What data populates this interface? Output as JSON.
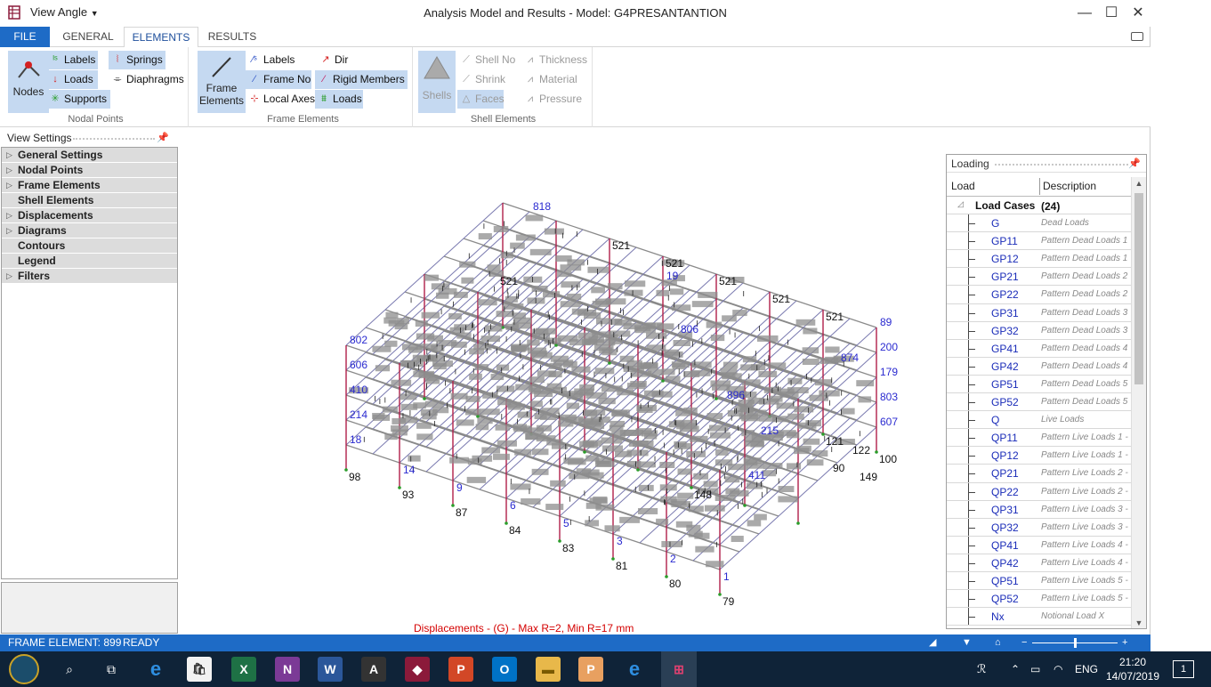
{
  "window": {
    "view_angle_label": "View Angle",
    "title": "Analysis Model and Results - Model: G4PRESANTANTION",
    "min_glyph": "—",
    "max_glyph": "☐",
    "close_glyph": "✕"
  },
  "tabs": {
    "file": "FILE",
    "general": "GENERAL",
    "elements": "ELEMENTS",
    "results": "RESULTS"
  },
  "ribbon": {
    "nodal": {
      "caption": "Nodal Points",
      "nodes": "Nodes",
      "labels": "Labels",
      "loads": "Loads",
      "supports": "Supports",
      "springs": "Springs",
      "diaphragms": "Diaphragms"
    },
    "frame": {
      "caption": "Frame Elements",
      "frame_line1": "Frame",
      "frame_line2": "Elements",
      "labels": "Labels",
      "frame_no": "Frame No",
      "local_axes": "Local Axes",
      "dir": "Dir",
      "rigid_members": "Rigid Members",
      "loads": "Loads"
    },
    "shell": {
      "caption": "Shell Elements",
      "shells": "Shells",
      "shell_no": "Shell  No",
      "shrink": "Shrink",
      "faces": "Faces",
      "thickness": "Thickness",
      "material": "Material",
      "pressure": "Pressure"
    }
  },
  "view_settings": {
    "title": "View Settings",
    "items": [
      {
        "label": "General Settings",
        "expandable": true
      },
      {
        "label": "Nodal Points",
        "expandable": true
      },
      {
        "label": "Frame Elements",
        "expandable": true
      },
      {
        "label": "Shell Elements",
        "expandable": false
      },
      {
        "label": "Displacements",
        "expandable": true
      },
      {
        "label": "Diagrams",
        "expandable": true
      },
      {
        "label": "Contours",
        "expandable": false
      },
      {
        "label": "Legend",
        "expandable": false
      },
      {
        "label": "Filters",
        "expandable": true
      }
    ]
  },
  "canvas": {
    "caption": "Displacements - (G) - Max  R=2, Min  R=17 mm",
    "node_labels": [
      {
        "t": "98"
      },
      {
        "t": "93"
      },
      {
        "t": "87"
      },
      {
        "t": "84"
      },
      {
        "t": "83"
      },
      {
        "t": "81"
      },
      {
        "t": "80"
      },
      {
        "t": "79"
      },
      {
        "t": "100"
      },
      {
        "t": "149"
      },
      {
        "t": "90"
      },
      {
        "t": "121"
      },
      {
        "t": "122"
      },
      {
        "t": "148"
      },
      {
        "t": "521"
      },
      {
        "t": "521"
      },
      {
        "t": "521"
      },
      {
        "t": "521"
      },
      {
        "t": "521"
      },
      {
        "t": "521"
      }
    ],
    "member_labels": [
      {
        "t": "802"
      },
      {
        "t": "606"
      },
      {
        "t": "410"
      },
      {
        "t": "214"
      },
      {
        "t": "18"
      },
      {
        "t": "14"
      },
      {
        "t": "9"
      },
      {
        "t": "6"
      },
      {
        "t": "5"
      },
      {
        "t": "3"
      },
      {
        "t": "2"
      },
      {
        "t": "1"
      },
      {
        "t": "89"
      },
      {
        "t": "200"
      },
      {
        "t": "179"
      },
      {
        "t": "803"
      },
      {
        "t": "607"
      },
      {
        "t": "411"
      },
      {
        "t": "215"
      },
      {
        "t": "19"
      },
      {
        "t": "806"
      },
      {
        "t": "874"
      },
      {
        "t": "818"
      },
      {
        "t": "896"
      }
    ]
  },
  "loading": {
    "title": "Loading",
    "col_load": "Load",
    "col_description": "Description",
    "group": {
      "name": "Load Cases",
      "count": "(24)"
    },
    "rows": [
      {
        "load": "G",
        "desc": "Dead Loads"
      },
      {
        "load": "GP11",
        "desc": "Pattern Dead Loads 1"
      },
      {
        "load": "GP12",
        "desc": "Pattern Dead Loads 1"
      },
      {
        "load": "GP21",
        "desc": "Pattern Dead Loads 2"
      },
      {
        "load": "GP22",
        "desc": "Pattern Dead Loads 2"
      },
      {
        "load": "GP31",
        "desc": "Pattern Dead Loads 3"
      },
      {
        "load": "GP32",
        "desc": "Pattern Dead Loads 3"
      },
      {
        "load": "GP41",
        "desc": "Pattern Dead Loads 4"
      },
      {
        "load": "GP42",
        "desc": "Pattern Dead Loads 4"
      },
      {
        "load": "GP51",
        "desc": "Pattern Dead Loads 5"
      },
      {
        "load": "GP52",
        "desc": "Pattern Dead Loads 5"
      },
      {
        "load": "Q",
        "desc": "Live Loads"
      },
      {
        "load": "QP11",
        "desc": "Pattern Live Loads 1 -"
      },
      {
        "load": "QP12",
        "desc": "Pattern Live Loads 1 -"
      },
      {
        "load": "QP21",
        "desc": "Pattern Live Loads 2 -"
      },
      {
        "load": "QP22",
        "desc": "Pattern Live Loads 2 -"
      },
      {
        "load": "QP31",
        "desc": "Pattern Live Loads 3 -"
      },
      {
        "load": "QP32",
        "desc": "Pattern Live Loads 3 -"
      },
      {
        "load": "QP41",
        "desc": "Pattern Live Loads 4 -"
      },
      {
        "load": "QP42",
        "desc": "Pattern Live Loads 4 -"
      },
      {
        "load": "QP51",
        "desc": "Pattern Live Loads 5 -"
      },
      {
        "load": "QP52",
        "desc": "Pattern Live Loads 5 -"
      },
      {
        "load": "Nx",
        "desc": "Notional Load X"
      }
    ]
  },
  "status": {
    "frame_element": "FRAME ELEMENT: 899",
    "state": "READY"
  },
  "taskbar": {
    "language": "ENG",
    "time": "21:20",
    "date": "14/07/2019",
    "notification_count": "1"
  },
  "colors": {
    "accent": "#1e6bc6",
    "ribbon_selected": "#c5d9f1",
    "load_name": "#1a2cb8",
    "caption_red": "#d40000",
    "taskbar": "#0f2338"
  }
}
